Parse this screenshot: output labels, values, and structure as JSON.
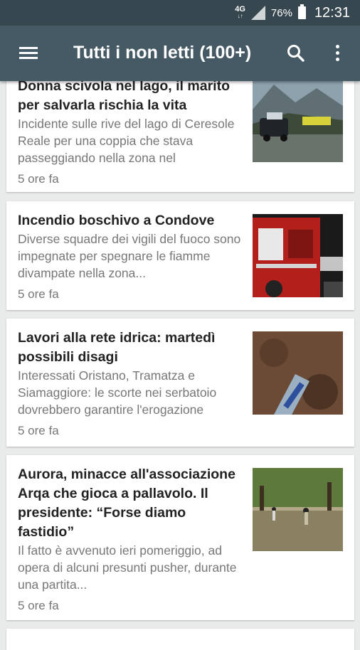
{
  "status": {
    "network": "4G",
    "battery": "76%",
    "time": "12:31"
  },
  "app_bar": {
    "title": "Tutti i non letti (100+)"
  },
  "articles": [
    {
      "title": "Donna scivola nel lago, il marito per salvarla rischia la vita",
      "snippet": "Incidente sulle rive del lago di Ceresole Reale per una coppia che stava passeggiando nella zona nel",
      "time": "5 ore fa",
      "image": "lake-rescue-photo"
    },
    {
      "title": "Incendio boschivo a Condove",
      "snippet": "Diverse squadre dei vigili del fuoco sono impegnate per spegnare le fiamme divampate nella zona...",
      "time": "5 ore fa",
      "image": "fire-truck-photo"
    },
    {
      "title": "Lavori alla rete idrica: martedì possibili disagi",
      "snippet": "Interessati Oristano, Tramatza e Siamaggiore: le scorte nei serbatoio dovrebbero garantire l'erogazione",
      "time": "5 ore fa",
      "image": "water-pipe-photo"
    },
    {
      "title": "Aurora, minacce all'associazione Arqa che gioca a pallavolo. Il presidente: “Forse diamo fastidio”",
      "snippet": "Il fatto è avvenuto ieri pomeriggio, ad opera di alcuni presunti pusher, durante una partita...",
      "time": "5 ore fa",
      "image": "volleyball-park-photo"
    }
  ]
}
